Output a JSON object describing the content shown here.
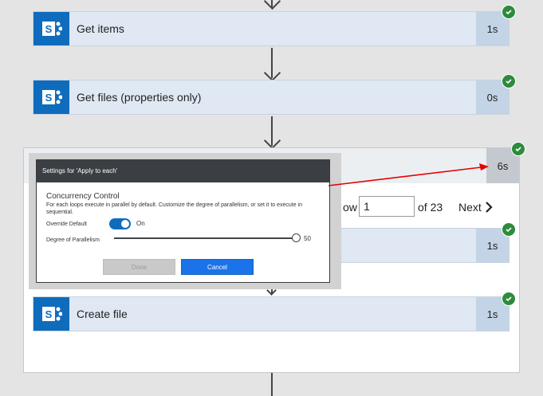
{
  "flow": {
    "get_items": {
      "title": "Get items",
      "duration": "1s"
    },
    "get_files": {
      "title": "Get files (properties only)",
      "duration": "0s"
    },
    "apply_to_each": {
      "duration": "6s"
    },
    "inner_action": {
      "duration": "1s"
    },
    "create_file": {
      "title": "Create file",
      "duration": "1s"
    }
  },
  "pager": {
    "prefix": "ow",
    "current": "1",
    "of_text": "of 23",
    "next_label": "Next"
  },
  "dialog": {
    "title": "Settings for 'Apply to each'",
    "section_title": "Concurrency Control",
    "description": "For each loops execute in parallel by default. Customize the degree of parallelism, or set it to execute in sequential.",
    "override_label": "Override Default",
    "toggle_state": "On",
    "parallelism_label": "Degree of Parallelism",
    "parallelism_value": "50",
    "parallelism_level": 1.0,
    "done_label": "Done",
    "cancel_label": "Cancel"
  },
  "icons": [
    "sharepoint-icon",
    "check-icon",
    "chevron-right-icon",
    "arrow-down-icon"
  ],
  "colors": {
    "accent": "#0f6cbd",
    "success": "#2e8b3d",
    "annotation_arrow": "#e60000"
  }
}
